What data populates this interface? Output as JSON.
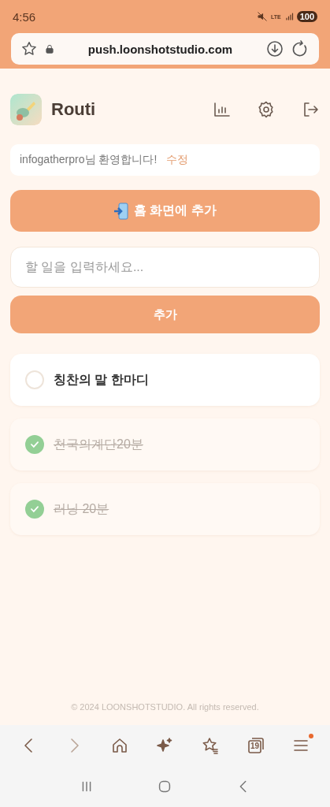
{
  "status_bar": {
    "time": "4:56",
    "network": "LTE",
    "battery": "100"
  },
  "browser": {
    "url": "push.loonshotstudio.com"
  },
  "app": {
    "title": "Routi"
  },
  "welcome": {
    "text": "infogatherpro님 환영합니다!",
    "edit_link": "수정"
  },
  "home_button": {
    "label": "홈 화면에 추가"
  },
  "task_input": {
    "placeholder": "할 일을 입력하세요..."
  },
  "add_button": {
    "label": "추가"
  },
  "tasks": [
    {
      "title": "칭찬의 말 한마디",
      "checked": false
    },
    {
      "title": "천국의계단20분",
      "checked": true
    },
    {
      "title": "러닝 20분",
      "checked": true
    }
  ],
  "footer": "© 2024 LOONSHOTSTUDIO. All rights reserved.",
  "toolbar": {
    "tab_count": "19",
    "menu_notification": true
  }
}
